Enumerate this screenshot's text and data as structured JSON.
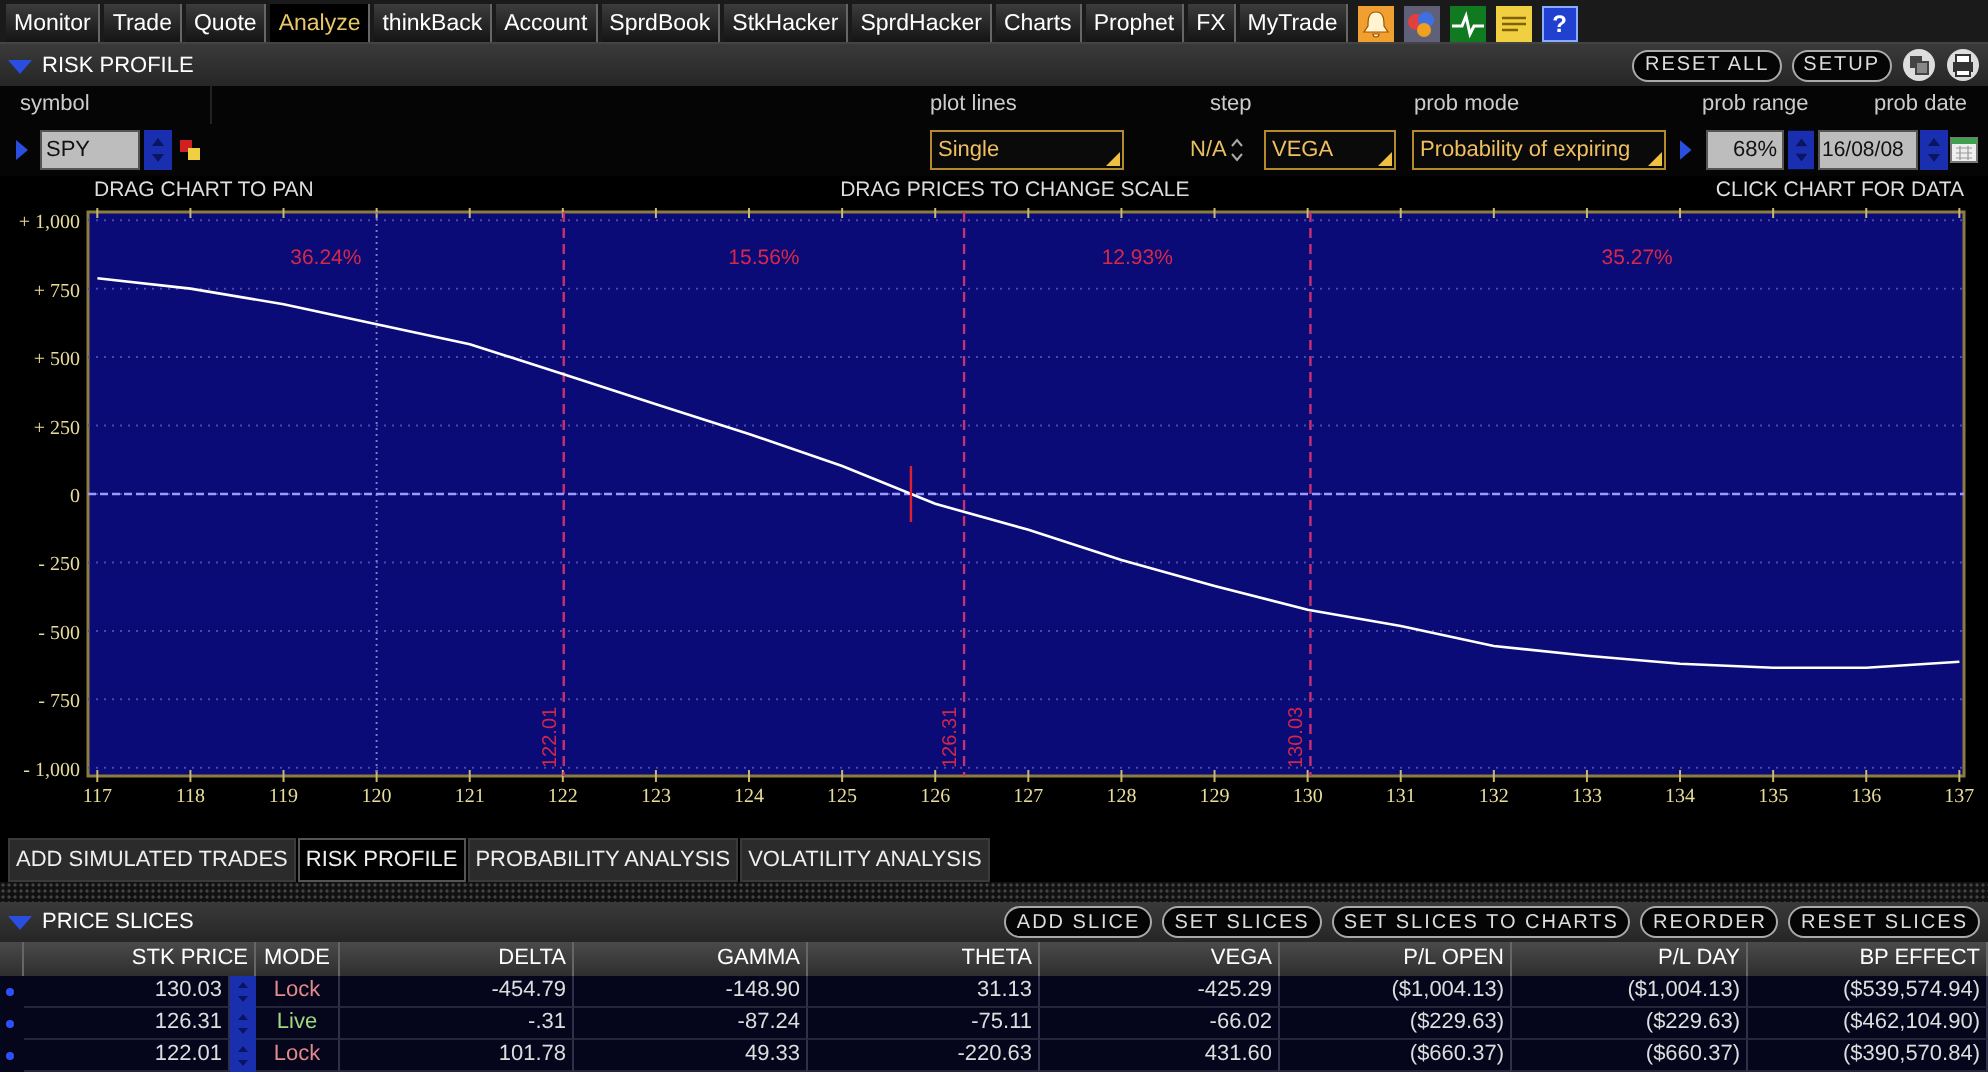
{
  "nav_tabs": [
    {
      "label": "Monitor",
      "selected": false
    },
    {
      "label": "Trade",
      "selected": false
    },
    {
      "label": "Quote",
      "selected": false
    },
    {
      "label": "Analyze",
      "selected": true
    },
    {
      "label": "thinkBack",
      "selected": false
    },
    {
      "label": "Account",
      "selected": false
    },
    {
      "label": "SprdBook",
      "selected": false
    },
    {
      "label": "StkHacker",
      "selected": false
    },
    {
      "label": "SprdHacker",
      "selected": false
    },
    {
      "label": "Charts",
      "selected": false
    },
    {
      "label": "Prophet",
      "selected": false
    },
    {
      "label": "FX",
      "selected": false
    },
    {
      "label": "MyTrade",
      "selected": false
    }
  ],
  "toolbar_icons": [
    {
      "kind": "alert"
    },
    {
      "kind": "circles"
    },
    {
      "kind": "pulse"
    },
    {
      "kind": "note"
    },
    {
      "kind": "help",
      "label": "?"
    }
  ],
  "risk_profile": {
    "title": "RISK PROFILE",
    "expanded": true,
    "buttons": [
      "RESET ALL",
      "SETUP"
    ],
    "symbol": {
      "label": "symbol",
      "value": "SPY"
    },
    "plot_lines": {
      "label": "plot lines",
      "value": "Single"
    },
    "step": {
      "label": "step",
      "value": "N/A"
    },
    "greek": {
      "value": "VEGA"
    },
    "prob_mode": {
      "label": "prob mode",
      "value": "Probability of expiring"
    },
    "prob_range": {
      "label": "prob range",
      "value": "68%"
    },
    "prob_date": {
      "label": "prob date",
      "value": "16/08/08"
    },
    "hints": [
      "DRAG CHART TO PAN",
      "DRAG PRICES TO CHANGE SCALE",
      "CLICK CHART FOR DATA"
    ],
    "chart_data": {
      "type": "line",
      "x": [
        117,
        118,
        119,
        120,
        121,
        122,
        123,
        124,
        125,
        126,
        127,
        128,
        129,
        130,
        131,
        132,
        133,
        134,
        135,
        136,
        137
      ],
      "series": [
        {
          "color": "#ffffff",
          "values": [
            788,
            750,
            693,
            620,
            547,
            438,
            328,
            219,
            102,
            -36,
            -131,
            -241,
            -336,
            -423,
            -482,
            -555,
            -591,
            -620,
            -635,
            -635,
            -613
          ]
        }
      ],
      "xlim": [
        116.9,
        137.05
      ],
      "ylim": [
        -1030,
        1030
      ],
      "grid": true,
      "xticks": [
        117,
        118,
        119,
        120,
        121,
        122,
        123,
        124,
        125,
        126,
        127,
        128,
        129,
        130,
        131,
        132,
        133,
        134,
        135,
        136,
        137
      ],
      "yticks": [
        {
          "value": 1000,
          "label": "+ 1,000"
        },
        {
          "value": 750,
          "label": "+ 750"
        },
        {
          "value": 500,
          "label": "+ 500"
        },
        {
          "value": 250,
          "label": "+ 250"
        },
        {
          "value": 0,
          "label": "0"
        },
        {
          "value": -250,
          "label": "- 250"
        },
        {
          "value": -500,
          "label": "- 500"
        },
        {
          "value": -750,
          "label": "- 750"
        },
        {
          "value": -1000,
          "label": "- 1,000"
        }
      ],
      "ref_lines": [
        {
          "axis": "x",
          "value": 120
        },
        {
          "axis": "x",
          "value": 122.01,
          "label": "122.01"
        },
        {
          "axis": "x",
          "value": 126.31,
          "label": "126.31"
        },
        {
          "axis": "x",
          "value": 130.03,
          "label": "130.03"
        },
        {
          "axis": "y",
          "value": 0
        }
      ],
      "annotations": [
        "36.24%",
        "15.56%",
        "12.93%",
        "35.27%"
      ]
    }
  },
  "analysis_tabs": [
    {
      "label": "ADD SIMULATED TRADES",
      "selected": false
    },
    {
      "label": "RISK PROFILE",
      "selected": true
    },
    {
      "label": "PROBABILITY ANALYSIS",
      "selected": false
    },
    {
      "label": "VOLATILITY ANALYSIS",
      "selected": false
    }
  ],
  "price_slices": {
    "title": "PRICE SLICES",
    "expanded": true,
    "buttons": [
      "ADD SLICE",
      "SET SLICES",
      "SET SLICES TO CHARTS",
      "REORDER",
      "RESET SLICES"
    ],
    "columns": [
      "STK PRICE",
      "MODE",
      "DELTA",
      "GAMMA",
      "THETA",
      "VEGA",
      "P/L OPEN",
      "P/L DAY",
      "BP EFFECT"
    ],
    "rows": [
      {
        "stk_price": "130.03",
        "mode": "Lock",
        "locked": true,
        "values": [
          "-454.79",
          "-148.90",
          "31.13",
          "-425.29",
          "($1,004.13)",
          "($1,004.13)",
          "($539,574.94)"
        ]
      },
      {
        "stk_price": "126.31",
        "mode": "Live",
        "locked": false,
        "values": [
          "-.31",
          "-87.24",
          "-75.11",
          "-66.02",
          "($229.63)",
          "($229.63)",
          "($462,104.90)"
        ]
      },
      {
        "stk_price": "122.01",
        "mode": "Lock",
        "locked": true,
        "values": [
          "101.78",
          "49.33",
          "-220.63",
          "431.60",
          "($660.37)",
          "($660.37)",
          "($390,570.84)"
        ]
      }
    ]
  }
}
